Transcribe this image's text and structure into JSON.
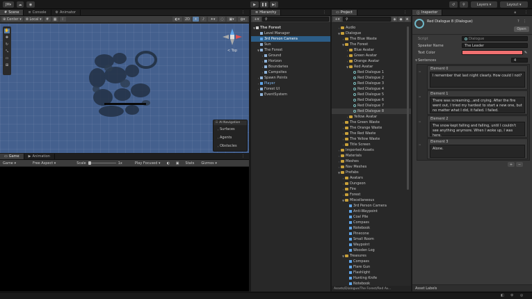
{
  "toolbar": {
    "account": "JM",
    "layers_label": "Layers",
    "layout_label": "Layout"
  },
  "scene": {
    "tabs": [
      "Scene",
      "Console",
      "Animator"
    ],
    "tools": {
      "center": "Center",
      "local": "Local",
      "mode_2d": "2D"
    },
    "gizmo_label": "< Top",
    "nav_overlay": {
      "title": "AI Navigation",
      "items": [
        "Surfaces",
        "Agents",
        "Obstacles"
      ]
    }
  },
  "game": {
    "tabs": [
      "Game",
      "Animation"
    ],
    "display": "Game",
    "aspect": "Free Aspect",
    "scale_label": "Scale",
    "scale_value": "1x",
    "play_focused": "Play Focused",
    "stats": "Stats",
    "gizmos": "Gizmos"
  },
  "hierarchy": {
    "tab": "Hierarchy",
    "items": [
      {
        "label": "The Forest",
        "depth": 0,
        "arrow": "▼",
        "icon": "white",
        "bold": true
      },
      {
        "label": "Level Manager",
        "depth": 1,
        "arrow": "",
        "icon": "cube"
      },
      {
        "label": "3rd Person Camera",
        "depth": 1,
        "arrow": "",
        "icon": "blue",
        "sel": true
      },
      {
        "label": "Sun",
        "depth": 1,
        "arrow": "",
        "icon": "cube"
      },
      {
        "label": "The Forest",
        "depth": 1,
        "arrow": "▼",
        "icon": "cube"
      },
      {
        "label": "Ground",
        "depth": 2,
        "arrow": ">",
        "icon": "cube"
      },
      {
        "label": "Horizon",
        "depth": 2,
        "arrow": ">",
        "icon": "cube"
      },
      {
        "label": "Boundaries",
        "depth": 2,
        "arrow": ">",
        "icon": "cube"
      },
      {
        "label": "Campsites",
        "depth": 2,
        "arrow": ">",
        "icon": "cube"
      },
      {
        "label": "Spawn Points",
        "depth": 1,
        "arrow": ">",
        "icon": "cube"
      },
      {
        "label": "Player",
        "depth": 1,
        "arrow": ">",
        "icon": "blue",
        "blue": true
      },
      {
        "label": "Forest UI",
        "depth": 1,
        "arrow": ">",
        "icon": "cube"
      },
      {
        "label": "EventSystem",
        "depth": 1,
        "arrow": "",
        "icon": "cube"
      }
    ]
  },
  "project": {
    "tab": "Project",
    "items": [
      {
        "label": "Audio",
        "depth": 1,
        "arrow": ">",
        "icon": "fold"
      },
      {
        "label": "Dialogue",
        "depth": 1,
        "arrow": "▼",
        "icon": "fold"
      },
      {
        "label": "The Blue Waste",
        "depth": 2,
        "arrow": ">",
        "icon": "fold"
      },
      {
        "label": "The Forest",
        "depth": 2,
        "arrow": "▼",
        "icon": "fold"
      },
      {
        "label": "Blue Avatar",
        "depth": 3,
        "arrow": ">",
        "icon": "fold"
      },
      {
        "label": "Green Avatar",
        "depth": 3,
        "arrow": ">",
        "icon": "fold"
      },
      {
        "label": "Orange Avatar",
        "depth": 3,
        "arrow": ">",
        "icon": "fold"
      },
      {
        "label": "Red Avatar",
        "depth": 3,
        "arrow": "▼",
        "icon": "fold"
      },
      {
        "label": "Red Dialogue 1",
        "depth": 4,
        "arrow": "",
        "icon": "so"
      },
      {
        "label": "Red Dialogue 2",
        "depth": 4,
        "arrow": "",
        "icon": "so"
      },
      {
        "label": "Red Dialogue 3",
        "depth": 4,
        "arrow": "",
        "icon": "so"
      },
      {
        "label": "Red Dialogue 4",
        "depth": 4,
        "arrow": "",
        "icon": "so"
      },
      {
        "label": "Red Dialogue 5",
        "depth": 4,
        "arrow": "",
        "icon": "so"
      },
      {
        "label": "Red Dialogue 6",
        "depth": 4,
        "arrow": "",
        "icon": "so"
      },
      {
        "label": "Red Dialogue 7",
        "depth": 4,
        "arrow": "",
        "icon": "so"
      },
      {
        "label": "Red Dialogue 8",
        "depth": 4,
        "arrow": "",
        "icon": "so",
        "hl": true
      },
      {
        "label": "Yellow Avatar",
        "depth": 3,
        "arrow": ">",
        "icon": "fold"
      },
      {
        "label": "The Green Waste",
        "depth": 2,
        "arrow": ">",
        "icon": "fold"
      },
      {
        "label": "The Orange Waste",
        "depth": 2,
        "arrow": ">",
        "icon": "fold"
      },
      {
        "label": "The Red Waste",
        "depth": 2,
        "arrow": ">",
        "icon": "fold"
      },
      {
        "label": "The Yellow Waste",
        "depth": 2,
        "arrow": ">",
        "icon": "fold"
      },
      {
        "label": "Title Screen",
        "depth": 2,
        "arrow": ">",
        "icon": "fold"
      },
      {
        "label": "Imported Assets",
        "depth": 1,
        "arrow": ">",
        "icon": "fold"
      },
      {
        "label": "Materials",
        "depth": 1,
        "arrow": ">",
        "icon": "fold"
      },
      {
        "label": "Meshes",
        "depth": 1,
        "arrow": ">",
        "icon": "fold"
      },
      {
        "label": "Nav Meshes",
        "depth": 1,
        "arrow": ">",
        "icon": "fold"
      },
      {
        "label": "Prefabs",
        "depth": 1,
        "arrow": "▼",
        "icon": "fold"
      },
      {
        "label": "Avatars",
        "depth": 2,
        "arrow": ">",
        "icon": "fold"
      },
      {
        "label": "Dungeon",
        "depth": 2,
        "arrow": ">",
        "icon": "fold"
      },
      {
        "label": "Fire",
        "depth": 2,
        "arrow": ">",
        "icon": "fold"
      },
      {
        "label": "Forest",
        "depth": 2,
        "arrow": ">",
        "icon": "fold"
      },
      {
        "label": "Miscellaneous",
        "depth": 2,
        "arrow": "▼",
        "icon": "fold"
      },
      {
        "label": "3rd Person Camera",
        "depth": 3,
        "arrow": "",
        "icon": "blue"
      },
      {
        "label": "Anti-Waypoint",
        "depth": 3,
        "arrow": "",
        "icon": "blue"
      },
      {
        "label": "Coal Pile",
        "depth": 3,
        "arrow": "",
        "icon": "blue"
      },
      {
        "label": "Compass",
        "depth": 3,
        "arrow": "",
        "icon": "blue"
      },
      {
        "label": "Notebook",
        "depth": 3,
        "arrow": "",
        "icon": "blue"
      },
      {
        "label": "Pinecone",
        "depth": 3,
        "arrow": "",
        "icon": "blue"
      },
      {
        "label": "Small Room",
        "depth": 3,
        "arrow": "",
        "icon": "blue"
      },
      {
        "label": "Waypoint",
        "depth": 3,
        "arrow": "",
        "icon": "blue"
      },
      {
        "label": "Wooden Log",
        "depth": 3,
        "arrow": "",
        "icon": "blue"
      },
      {
        "label": "Treasures",
        "depth": 2,
        "arrow": "▼",
        "icon": "fold"
      },
      {
        "label": "Compass",
        "depth": 3,
        "arrow": "",
        "icon": "blue"
      },
      {
        "label": "Flare Gun",
        "depth": 3,
        "arrow": "",
        "icon": "blue"
      },
      {
        "label": "Flashlight",
        "depth": 3,
        "arrow": "",
        "icon": "blue"
      },
      {
        "label": "Hunting Knife",
        "depth": 3,
        "arrow": "",
        "icon": "blue"
      },
      {
        "label": "Notebook",
        "depth": 3,
        "arrow": "",
        "icon": "blue"
      },
      {
        "label": "Town",
        "depth": 2,
        "arrow": ">",
        "icon": "fold"
      }
    ],
    "footer_path": "Assets/Dialogue/The Forest/Red Av..."
  },
  "inspector": {
    "tab": "Inspector",
    "title": "Red Dialogue 8 (Dialogue)",
    "open_label": "Open",
    "script_label": "Script",
    "script_value": "Dialogue",
    "speaker_label": "Speaker Name",
    "speaker_value": "The Leader",
    "color_label": "Text Color",
    "text_color": "#f07070",
    "sentences_label": "Sentences",
    "sentences_count": "4",
    "elements": [
      {
        "label": "Element 0",
        "text": "I remember that last night clearly. How could I not?"
      },
      {
        "label": "Element 1",
        "text": "There was screaming...and crying. After the fire went out, I tried my hardest to start a new one, but no matter what I did, it failed. I failed."
      },
      {
        "label": "Element 2",
        "text": "The snow kept falling and falling, until I couldn't see anything anymore. When I woke up, I was here."
      },
      {
        "label": "Element 3",
        "text": "Alone."
      }
    ],
    "asset_labels": "Asset Labels"
  }
}
